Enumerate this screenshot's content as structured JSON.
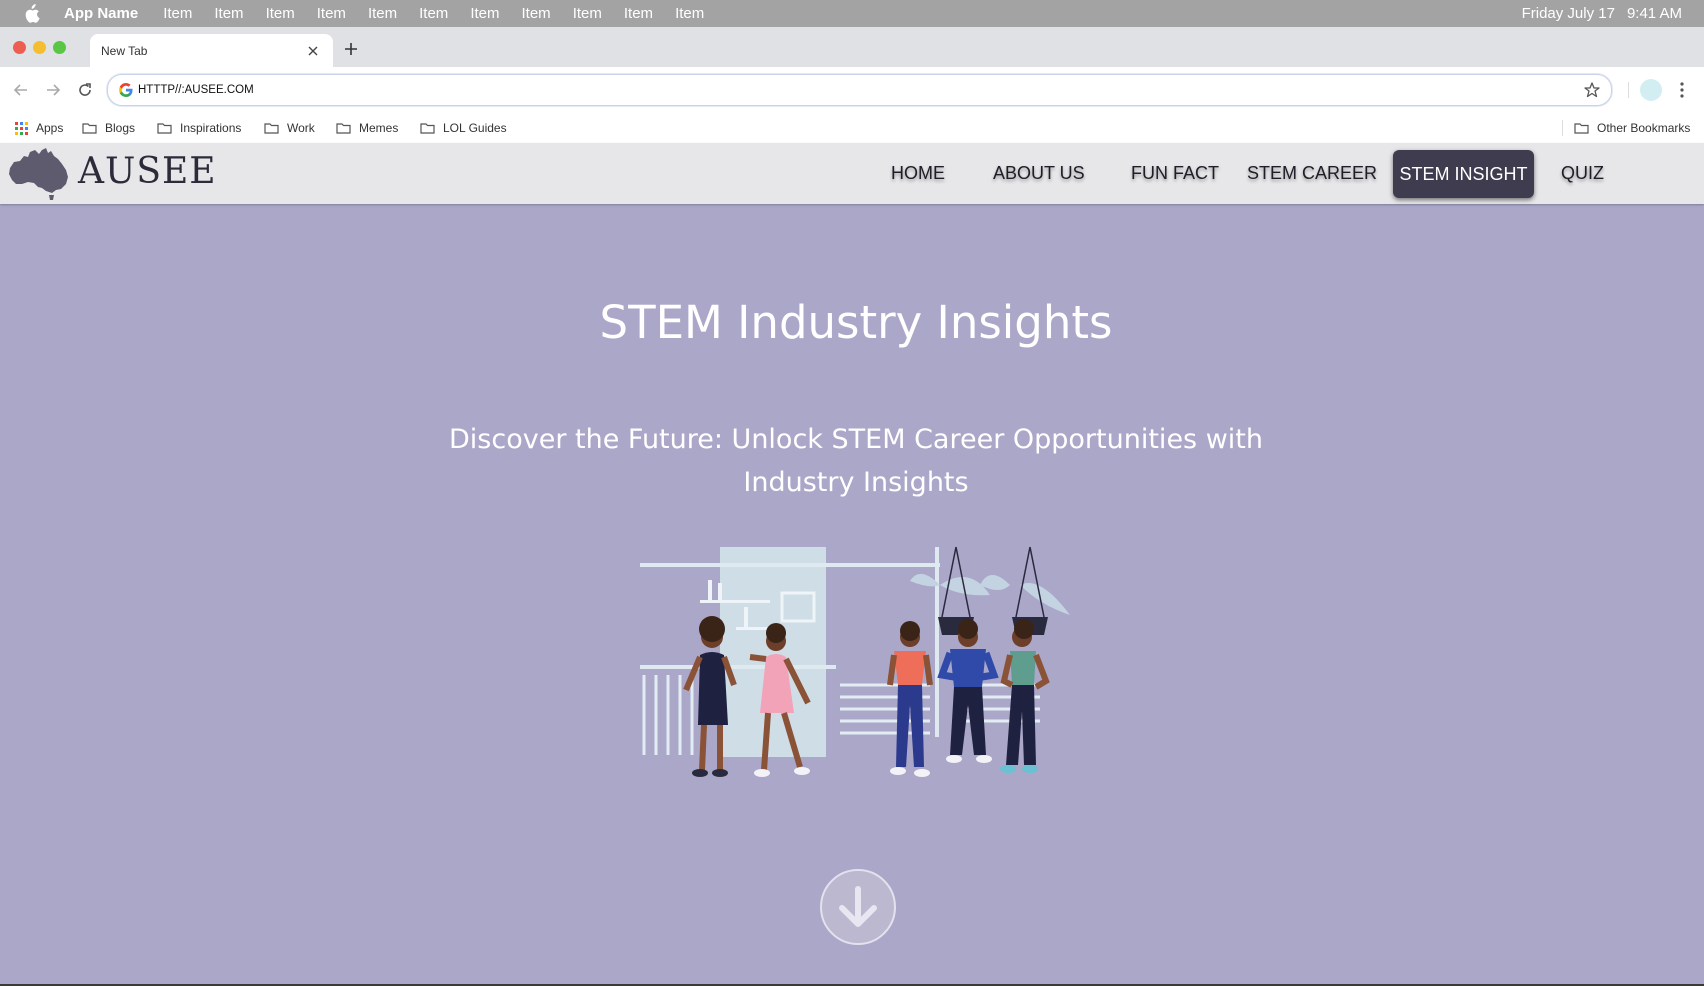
{
  "menubar": {
    "app_name": "App Name",
    "items": [
      "Item",
      "Item",
      "Item",
      "Item",
      "Item",
      "Item",
      "Item",
      "Item",
      "Item",
      "Item",
      "Item"
    ],
    "date": "Friday July 17",
    "time": "9:41 AM"
  },
  "browser": {
    "tab_title": "New Tab",
    "url": "HTTTP//:AUSEE.COM",
    "bookmarks": {
      "apps": "Apps",
      "blogs": "Blogs",
      "inspirations": "Inspirations",
      "work": "Work",
      "memes": "Memes",
      "lol_guides": "LOL Guides",
      "other": "Other Bookmarks"
    }
  },
  "site": {
    "brand": "AUSEE",
    "nav": {
      "home": "HOME",
      "about": "ABOUT US",
      "fun_fact": "FUN FACT",
      "stem_career": "STEM CAREER",
      "stem_insight": "STEM INSIGHT",
      "quiz": "QUIZ"
    },
    "active_nav": "STEM INSIGHT",
    "hero": {
      "title": "STEM Industry Insights",
      "subtitle": "Discover the Future: Unlock STEM Career Opportunities with Industry Insights"
    }
  },
  "colors": {
    "page_background": "#aaa7c9",
    "nav_background": "#e7e7e9",
    "active_nav_background": "#403c4f"
  },
  "icons": {
    "menubar": "apple-icon",
    "hero": "arrow-down-circle-icon"
  }
}
